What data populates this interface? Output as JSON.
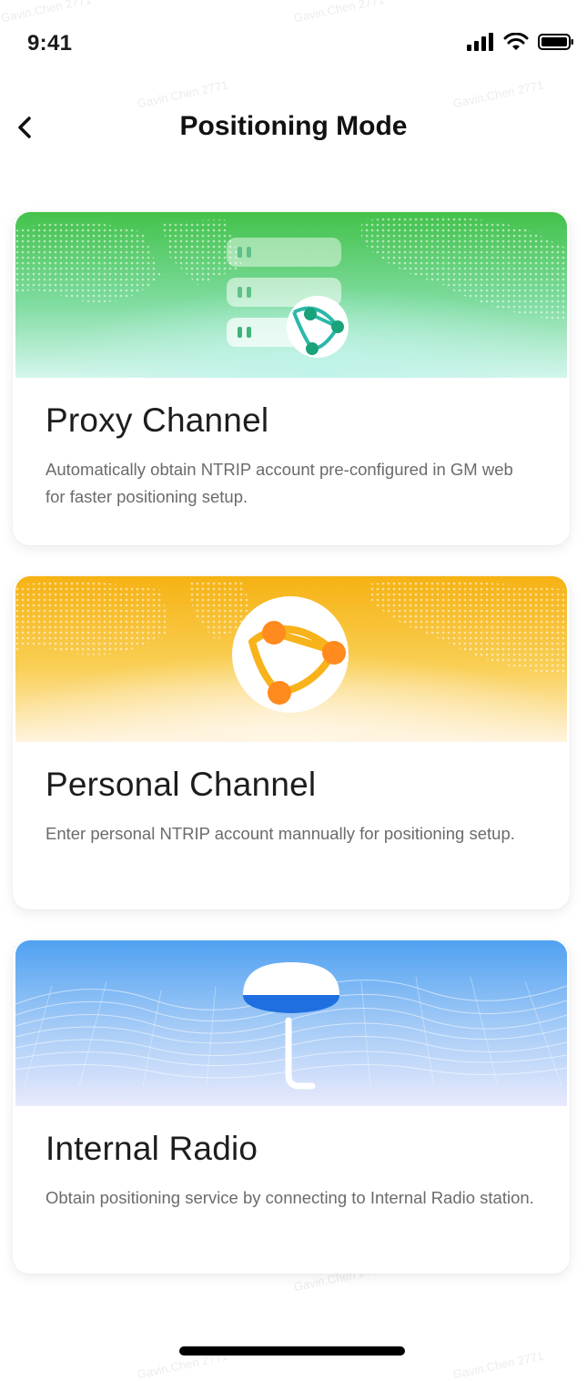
{
  "status_bar": {
    "time": "9:41"
  },
  "nav": {
    "title": "Positioning Mode"
  },
  "cards": [
    {
      "title": "Proxy Channel",
      "description": "Automatically obtain NTRIP account pre-configured in GM web for faster positioning setup.",
      "icon": "server-network-icon"
    },
    {
      "title": "Personal Channel",
      "description": "Enter personal NTRIP account mannually for positioning setup.",
      "icon": "globe-network-icon"
    },
    {
      "title": "Internal Radio",
      "description": "Obtain positioning service by connecting to Internal Radio station.",
      "icon": "gnss-receiver-icon"
    }
  ],
  "watermark": "Gavin.Chen 2771",
  "colors": {
    "green": "#4cc74e",
    "orange": "#f8b21a",
    "blue": "#5aa6f2",
    "accent_orange": "#ff8a1e",
    "teal": "#1aa27a"
  }
}
